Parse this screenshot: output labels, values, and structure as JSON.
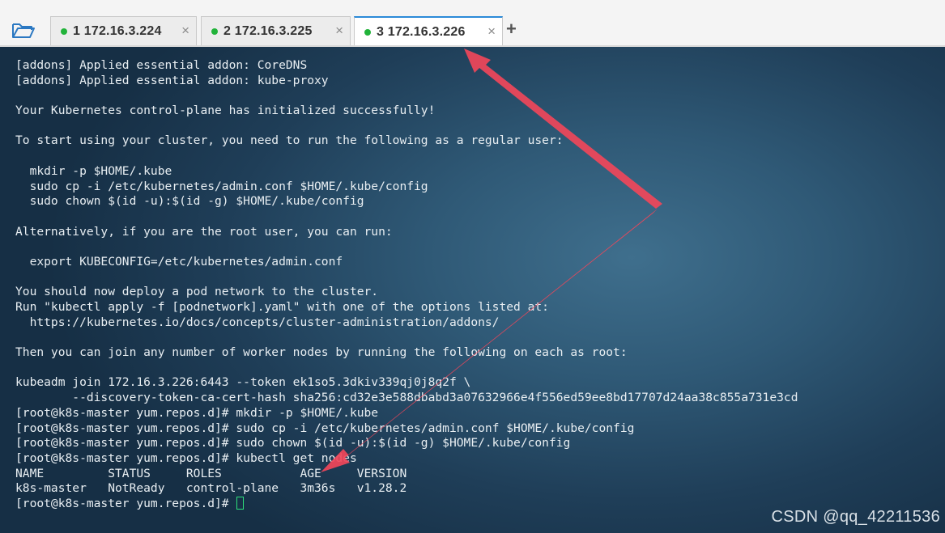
{
  "tabs": [
    {
      "number": "1",
      "host": "172.16.3.224",
      "active": false
    },
    {
      "number": "2",
      "host": "172.16.3.225",
      "active": false
    },
    {
      "number": "3",
      "host": "172.16.3.226",
      "active": true
    }
  ],
  "toolbar": {
    "open_icon": "folder-open-icon",
    "add_tab_label": "+",
    "close_label": "×"
  },
  "terminal": {
    "lines": [
      "[addons] Applied essential addon: CoreDNS",
      "[addons] Applied essential addon: kube-proxy",
      "",
      "Your Kubernetes control-plane has initialized successfully!",
      "",
      "To start using your cluster, you need to run the following as a regular user:",
      "",
      "  mkdir -p $HOME/.kube",
      "  sudo cp -i /etc/kubernetes/admin.conf $HOME/.kube/config",
      "  sudo chown $(id -u):$(id -g) $HOME/.kube/config",
      "",
      "Alternatively, if you are the root user, you can run:",
      "",
      "  export KUBECONFIG=/etc/kubernetes/admin.conf",
      "",
      "You should now deploy a pod network to the cluster.",
      "Run \"kubectl apply -f [podnetwork].yaml\" with one of the options listed at:",
      "  https://kubernetes.io/docs/concepts/cluster-administration/addons/",
      "",
      "Then you can join any number of worker nodes by running the following on each as root:",
      "",
      "kubeadm join 172.16.3.226:6443 --token ek1so5.3dkiv339qj0j8q2f \\",
      "        --discovery-token-ca-cert-hash sha256:cd32e3e588dbabd3a07632966e4f556ed59ee8bd17707d24aa38c855a731e3cd",
      "[root@k8s-master yum.repos.d]# mkdir -p $HOME/.kube",
      "[root@k8s-master yum.repos.d]# sudo cp -i /etc/kubernetes/admin.conf $HOME/.kube/config",
      "[root@k8s-master yum.repos.d]# sudo chown $(id -u):$(id -g) $HOME/.kube/config",
      "[root@k8s-master yum.repos.d]# kubectl get nodes",
      "NAME         STATUS     ROLES           AGE     VERSION",
      "k8s-master   NotReady   control-plane   3m36s   v1.28.2"
    ],
    "prompt": "[root@k8s-master yum.repos.d]# "
  },
  "annotation": {
    "arrow_color": "#f0465a"
  },
  "watermark": "CSDN @qq_42211536"
}
